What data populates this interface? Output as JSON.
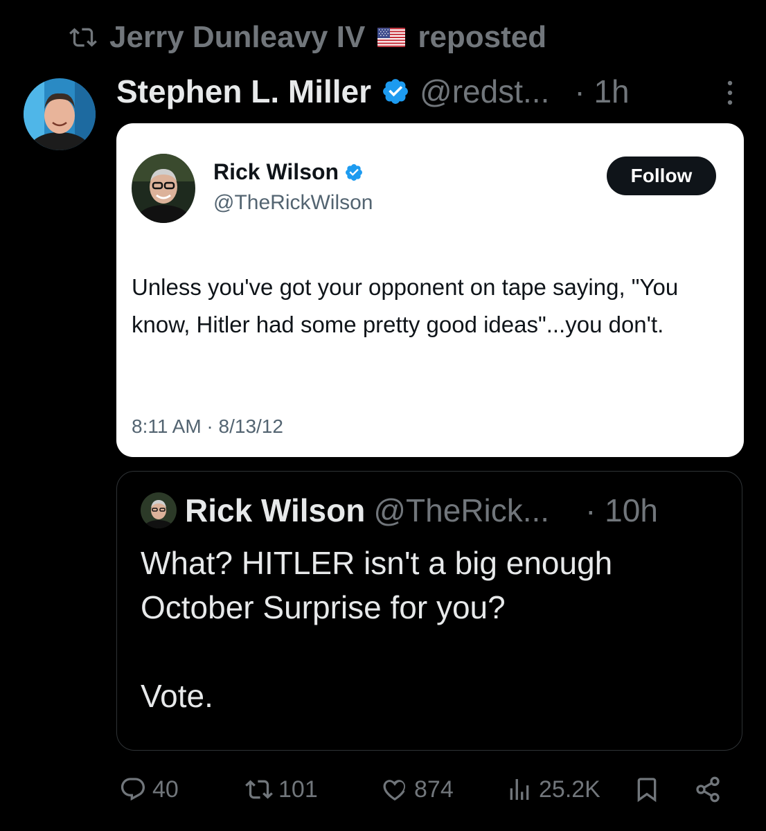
{
  "repost": {
    "icon": "repost-icon",
    "user": "Jerry Dunleavy IV",
    "flag": "us-flag-emoji",
    "suffix": "reposted"
  },
  "post": {
    "author_name": "Stephen L. Miller",
    "handle": "@redst...",
    "time": "· 1h",
    "verified_color": "#1d9bf0"
  },
  "card": {
    "name": "Rick Wilson",
    "handle": "@TheRickWilson",
    "follow_label": "Follow",
    "text": "Unless you've got your opponent on tape saying, \"You know, Hitler had some pretty good ideas\"...you don't.",
    "timestamp": "8:11 AM · 8/13/12"
  },
  "quote": {
    "name": "Rick Wilson",
    "handle": "@TheRick...",
    "time": "· 10h",
    "text": "What? HITLER isn't a big enough October Surprise for you?\n\nVote."
  },
  "actions": {
    "replies": "40",
    "reposts": "101",
    "likes": "874",
    "views": "25.2K"
  }
}
